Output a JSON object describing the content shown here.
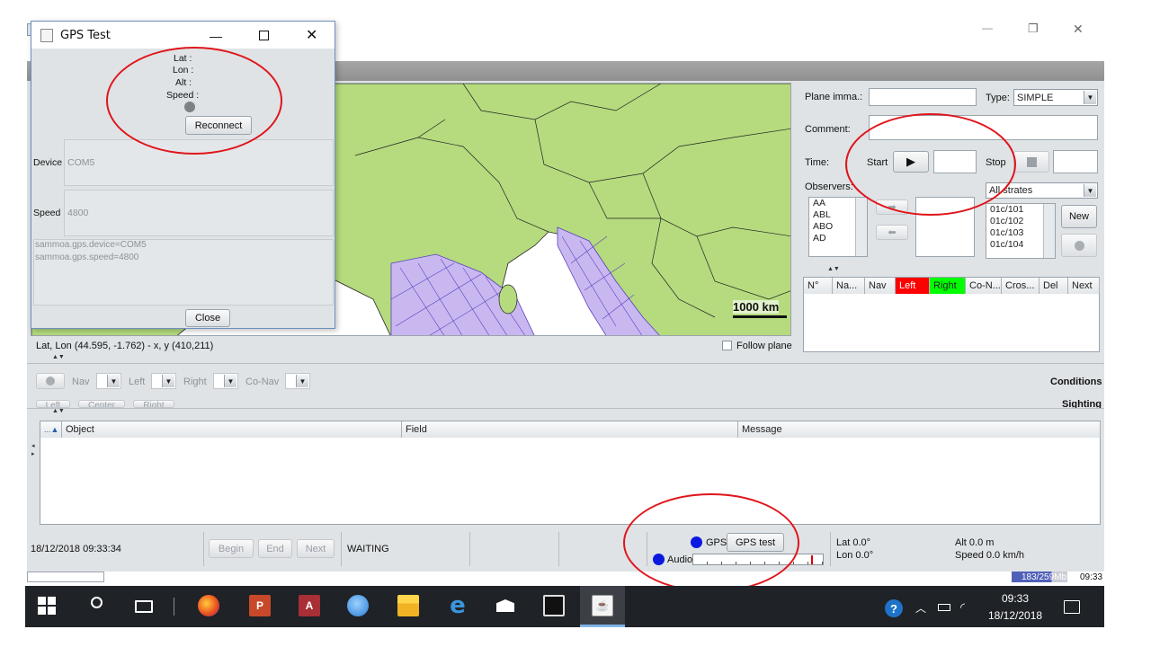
{
  "main_window": {
    "window_controls": {
      "minimize": "—",
      "maximize": "❐",
      "close": "✕"
    }
  },
  "map": {
    "scale_label": "1000 km",
    "coords_readout": "Lat, Lon (44.595, -1.762) - x, y (410,211)",
    "follow_plane_label": "Follow plane"
  },
  "right_panel": {
    "plane_label": "Plane imma.:",
    "plane_value": "",
    "type_label": "Type:",
    "type_value": "SIMPLE",
    "comment_label": "Comment:",
    "time_label": "Time:",
    "start_label": "Start",
    "stop_label": "Stop",
    "observers_label": "Observers:",
    "observers": [
      "AA",
      "ABL",
      "ABO",
      "AD"
    ],
    "strates_value": "All strates",
    "strates": [
      "01c/101",
      "01c/102",
      "01c/103",
      "01c/104"
    ],
    "new_button": "New",
    "table_headers": [
      "N°",
      "Na...",
      "Nav",
      "Left",
      "Right",
      "Co-N...",
      "Cros...",
      "Del",
      "Next"
    ]
  },
  "nav_bar": {
    "nav_label": "Nav",
    "left_label": "Left",
    "right_label": "Right",
    "conav_label": "Co-Nav",
    "left_btn": "Left",
    "center_btn": "Center",
    "right_btn": "Right",
    "conditions_label": "Conditions",
    "sighting_label": "Sighting"
  },
  "log_table": {
    "sort_indicator": "...▲",
    "headers": [
      "Object",
      "Field",
      "Message"
    ]
  },
  "status": {
    "datetime": "18/12/2018 09:33:34",
    "begin": "Begin",
    "end": "End",
    "next": "Next",
    "state": "WAITING",
    "gps_label": "GPS",
    "gps_test_button": "GPS test",
    "audio_label": "Audio",
    "lat": "Lat 0.0°",
    "lon": "Lon 0.0°",
    "alt": "Alt 0.0 m",
    "speed": "Speed 0.0 km/h",
    "memory": "183/259Mb",
    "time": "09:33"
  },
  "dialog": {
    "title": "GPS Test",
    "lat_label": "Lat :",
    "lon_label": "Lon :",
    "alt_label": "Alt :",
    "speed_label": "Speed :",
    "reconnect_button": "Reconnect",
    "device_label": "Device",
    "device_value": "COM5",
    "speed_field_label": "Speed",
    "speed_value": "4800",
    "props_lines": [
      "sammoa.gps.device=COM5",
      "sammoa.gps.speed=4800"
    ],
    "close_button": "Close"
  },
  "taskbar": {
    "clock_time": "09:33",
    "clock_date": "18/12/2018",
    "apps": [
      "Start",
      "Search",
      "Task View",
      "Firefox",
      "PowerPoint",
      "Access",
      "App",
      "File Explorer",
      "Edge",
      "Mail",
      "Terminal",
      "Java"
    ]
  },
  "colors": {
    "land": "#b5db7e",
    "sea_zone": "#c9b8f0",
    "annotation": "#e0151b",
    "left_header": "#ff0000",
    "right_header": "#00ff00",
    "gps_dot": "#0b18e0"
  }
}
